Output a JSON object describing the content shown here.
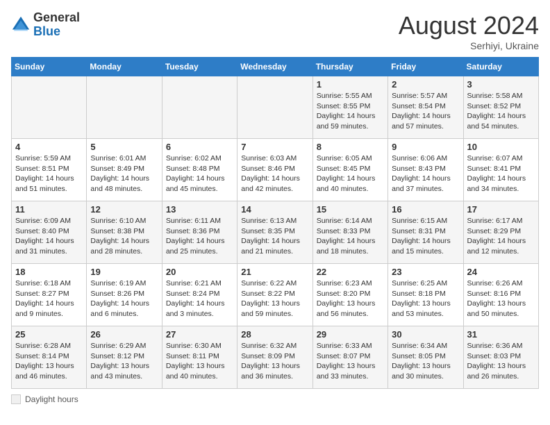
{
  "header": {
    "logo": {
      "general": "General",
      "blue": "Blue"
    },
    "month_year": "August 2024",
    "location": "Serhiyi, Ukraine"
  },
  "days_of_week": [
    "Sunday",
    "Monday",
    "Tuesday",
    "Wednesday",
    "Thursday",
    "Friday",
    "Saturday"
  ],
  "weeks": [
    [
      {
        "day": "",
        "info": ""
      },
      {
        "day": "",
        "info": ""
      },
      {
        "day": "",
        "info": ""
      },
      {
        "day": "",
        "info": ""
      },
      {
        "day": "1",
        "sunrise": "Sunrise: 5:55 AM",
        "sunset": "Sunset: 8:55 PM",
        "daylight": "Daylight: 14 hours and 59 minutes."
      },
      {
        "day": "2",
        "sunrise": "Sunrise: 5:57 AM",
        "sunset": "Sunset: 8:54 PM",
        "daylight": "Daylight: 14 hours and 57 minutes."
      },
      {
        "day": "3",
        "sunrise": "Sunrise: 5:58 AM",
        "sunset": "Sunset: 8:52 PM",
        "daylight": "Daylight: 14 hours and 54 minutes."
      }
    ],
    [
      {
        "day": "4",
        "sunrise": "Sunrise: 5:59 AM",
        "sunset": "Sunset: 8:51 PM",
        "daylight": "Daylight: 14 hours and 51 minutes."
      },
      {
        "day": "5",
        "sunrise": "Sunrise: 6:01 AM",
        "sunset": "Sunset: 8:49 PM",
        "daylight": "Daylight: 14 hours and 48 minutes."
      },
      {
        "day": "6",
        "sunrise": "Sunrise: 6:02 AM",
        "sunset": "Sunset: 8:48 PM",
        "daylight": "Daylight: 14 hours and 45 minutes."
      },
      {
        "day": "7",
        "sunrise": "Sunrise: 6:03 AM",
        "sunset": "Sunset: 8:46 PM",
        "daylight": "Daylight: 14 hours and 42 minutes."
      },
      {
        "day": "8",
        "sunrise": "Sunrise: 6:05 AM",
        "sunset": "Sunset: 8:45 PM",
        "daylight": "Daylight: 14 hours and 40 minutes."
      },
      {
        "day": "9",
        "sunrise": "Sunrise: 6:06 AM",
        "sunset": "Sunset: 8:43 PM",
        "daylight": "Daylight: 14 hours and 37 minutes."
      },
      {
        "day": "10",
        "sunrise": "Sunrise: 6:07 AM",
        "sunset": "Sunset: 8:41 PM",
        "daylight": "Daylight: 14 hours and 34 minutes."
      }
    ],
    [
      {
        "day": "11",
        "sunrise": "Sunrise: 6:09 AM",
        "sunset": "Sunset: 8:40 PM",
        "daylight": "Daylight: 14 hours and 31 minutes."
      },
      {
        "day": "12",
        "sunrise": "Sunrise: 6:10 AM",
        "sunset": "Sunset: 8:38 PM",
        "daylight": "Daylight: 14 hours and 28 minutes."
      },
      {
        "day": "13",
        "sunrise": "Sunrise: 6:11 AM",
        "sunset": "Sunset: 8:36 PM",
        "daylight": "Daylight: 14 hours and 25 minutes."
      },
      {
        "day": "14",
        "sunrise": "Sunrise: 6:13 AM",
        "sunset": "Sunset: 8:35 PM",
        "daylight": "Daylight: 14 hours and 21 minutes."
      },
      {
        "day": "15",
        "sunrise": "Sunrise: 6:14 AM",
        "sunset": "Sunset: 8:33 PM",
        "daylight": "Daylight: 14 hours and 18 minutes."
      },
      {
        "day": "16",
        "sunrise": "Sunrise: 6:15 AM",
        "sunset": "Sunset: 8:31 PM",
        "daylight": "Daylight: 14 hours and 15 minutes."
      },
      {
        "day": "17",
        "sunrise": "Sunrise: 6:17 AM",
        "sunset": "Sunset: 8:29 PM",
        "daylight": "Daylight: 14 hours and 12 minutes."
      }
    ],
    [
      {
        "day": "18",
        "sunrise": "Sunrise: 6:18 AM",
        "sunset": "Sunset: 8:27 PM",
        "daylight": "Daylight: 14 hours and 9 minutes."
      },
      {
        "day": "19",
        "sunrise": "Sunrise: 6:19 AM",
        "sunset": "Sunset: 8:26 PM",
        "daylight": "Daylight: 14 hours and 6 minutes."
      },
      {
        "day": "20",
        "sunrise": "Sunrise: 6:21 AM",
        "sunset": "Sunset: 8:24 PM",
        "daylight": "Daylight: 14 hours and 3 minutes."
      },
      {
        "day": "21",
        "sunrise": "Sunrise: 6:22 AM",
        "sunset": "Sunset: 8:22 PM",
        "daylight": "Daylight: 13 hours and 59 minutes."
      },
      {
        "day": "22",
        "sunrise": "Sunrise: 6:23 AM",
        "sunset": "Sunset: 8:20 PM",
        "daylight": "Daylight: 13 hours and 56 minutes."
      },
      {
        "day": "23",
        "sunrise": "Sunrise: 6:25 AM",
        "sunset": "Sunset: 8:18 PM",
        "daylight": "Daylight: 13 hours and 53 minutes."
      },
      {
        "day": "24",
        "sunrise": "Sunrise: 6:26 AM",
        "sunset": "Sunset: 8:16 PM",
        "daylight": "Daylight: 13 hours and 50 minutes."
      }
    ],
    [
      {
        "day": "25",
        "sunrise": "Sunrise: 6:28 AM",
        "sunset": "Sunset: 8:14 PM",
        "daylight": "Daylight: 13 hours and 46 minutes."
      },
      {
        "day": "26",
        "sunrise": "Sunrise: 6:29 AM",
        "sunset": "Sunset: 8:12 PM",
        "daylight": "Daylight: 13 hours and 43 minutes."
      },
      {
        "day": "27",
        "sunrise": "Sunrise: 6:30 AM",
        "sunset": "Sunset: 8:11 PM",
        "daylight": "Daylight: 13 hours and 40 minutes."
      },
      {
        "day": "28",
        "sunrise": "Sunrise: 6:32 AM",
        "sunset": "Sunset: 8:09 PM",
        "daylight": "Daylight: 13 hours and 36 minutes."
      },
      {
        "day": "29",
        "sunrise": "Sunrise: 6:33 AM",
        "sunset": "Sunset: 8:07 PM",
        "daylight": "Daylight: 13 hours and 33 minutes."
      },
      {
        "day": "30",
        "sunrise": "Sunrise: 6:34 AM",
        "sunset": "Sunset: 8:05 PM",
        "daylight": "Daylight: 13 hours and 30 minutes."
      },
      {
        "day": "31",
        "sunrise": "Sunrise: 6:36 AM",
        "sunset": "Sunset: 8:03 PM",
        "daylight": "Daylight: 13 hours and 26 minutes."
      }
    ]
  ],
  "legend": {
    "label": "Daylight hours"
  }
}
